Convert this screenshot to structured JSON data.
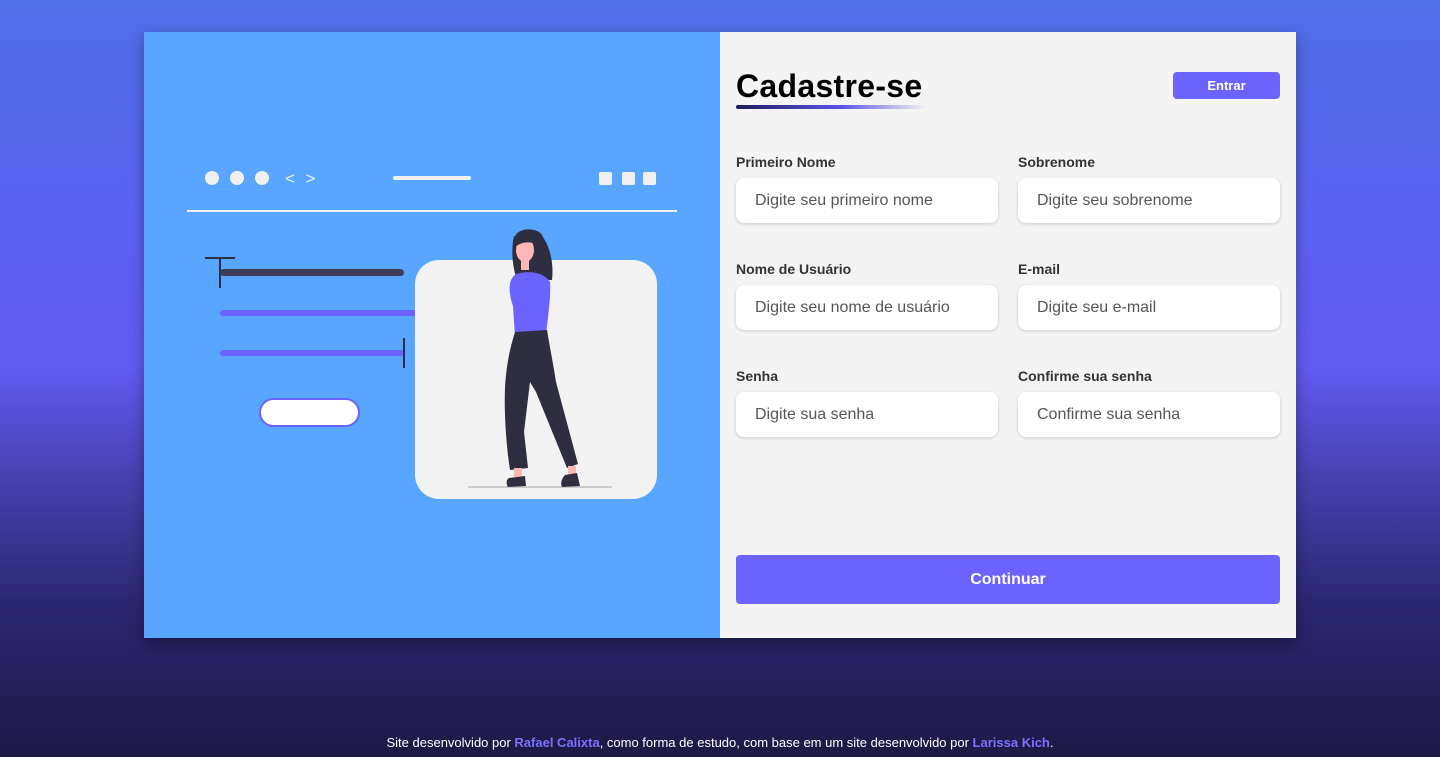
{
  "form": {
    "title": "Cadastre-se",
    "login_label": "Entrar",
    "fields": [
      {
        "label": "Primeiro Nome",
        "placeholder": "Digite seu primeiro nome"
      },
      {
        "label": "Sobrenome",
        "placeholder": "Digite seu sobrenome"
      },
      {
        "label": "Nome de Usuário",
        "placeholder": "Digite seu nome de usuário"
      },
      {
        "label": "E-mail",
        "placeholder": "Digite seu e-mail"
      },
      {
        "label": "Senha",
        "placeholder": "Digite sua senha"
      },
      {
        "label": "Confirme sua senha",
        "placeholder": "Confirme sua senha"
      }
    ],
    "continue_label": "Continuar"
  },
  "footer": {
    "prefix": "Site desenvolvido por ",
    "author": "Rafael Calixta",
    "middle": ", como forma de estudo, com base em um site desenvolvido por ",
    "original_author": "Larissa Kich",
    "suffix": "."
  },
  "colors": {
    "accent": "#6c63ff",
    "illustration_bg": "#58a6ff",
    "form_bg": "#f4f4f4"
  },
  "illustration": {
    "browser_nav_glyph": "< >"
  }
}
